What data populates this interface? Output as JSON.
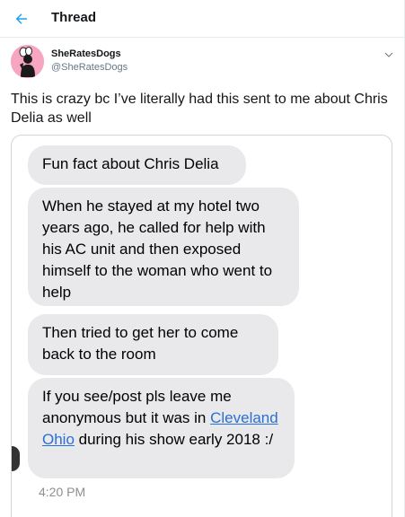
{
  "header": {
    "title": "Thread",
    "back_icon": "arrow-left-icon",
    "accent": "#1da1f2"
  },
  "tweet": {
    "display_name": "SheRatesDogs",
    "handle": "@SheRatesDogs",
    "text": "This is crazy bc I’ve literally had this sent to me about Chris Delia as well",
    "menu_icon": "chevron-down-icon"
  },
  "media": {
    "messages": [
      {
        "text": "Fun fact about Chris Delia"
      },
      {
        "text": "When he stayed at my hotel two years ago, he called for help with his AC unit and then exposed himself to the woman who went to help"
      },
      {
        "text": "Then tried to get her to come back to the room"
      },
      {
        "before": "If you see/post pls leave me anonymous but it was in ",
        "link": "Cleveland Ohio",
        "after": " during his show early 2018 :/"
      }
    ],
    "timestamp": "4:20 PM",
    "bubble_color": "#e9e9eb",
    "link_color": "#2a6fd6"
  }
}
